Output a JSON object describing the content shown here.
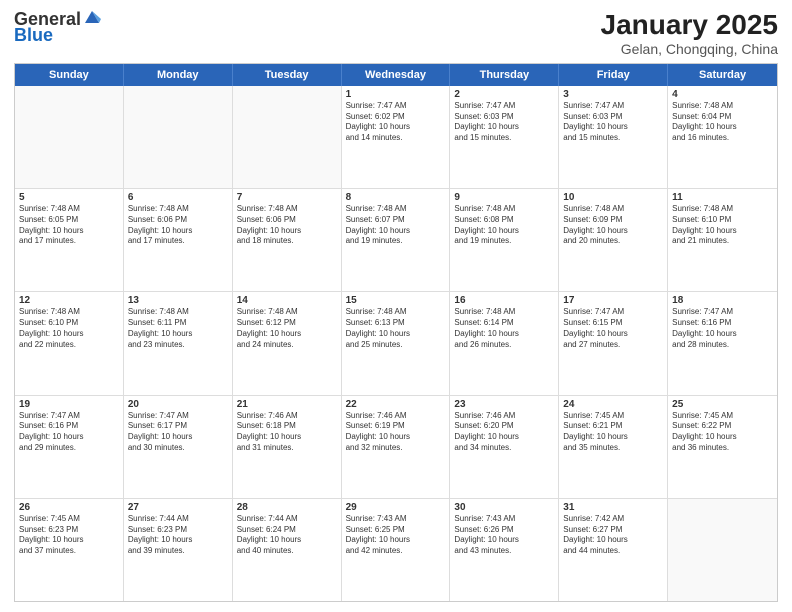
{
  "header": {
    "logo_general": "General",
    "logo_blue": "Blue",
    "title": "January 2025",
    "subtitle": "Gelan, Chongqing, China"
  },
  "weekdays": [
    "Sunday",
    "Monday",
    "Tuesday",
    "Wednesday",
    "Thursday",
    "Friday",
    "Saturday"
  ],
  "rows": [
    [
      {
        "day": "",
        "lines": [],
        "empty": true
      },
      {
        "day": "",
        "lines": [],
        "empty": true
      },
      {
        "day": "",
        "lines": [],
        "empty": true
      },
      {
        "day": "1",
        "lines": [
          "Sunrise: 7:47 AM",
          "Sunset: 6:02 PM",
          "Daylight: 10 hours",
          "and 14 minutes."
        ]
      },
      {
        "day": "2",
        "lines": [
          "Sunrise: 7:47 AM",
          "Sunset: 6:03 PM",
          "Daylight: 10 hours",
          "and 15 minutes."
        ]
      },
      {
        "day": "3",
        "lines": [
          "Sunrise: 7:47 AM",
          "Sunset: 6:03 PM",
          "Daylight: 10 hours",
          "and 15 minutes."
        ]
      },
      {
        "day": "4",
        "lines": [
          "Sunrise: 7:48 AM",
          "Sunset: 6:04 PM",
          "Daylight: 10 hours",
          "and 16 minutes."
        ]
      }
    ],
    [
      {
        "day": "5",
        "lines": [
          "Sunrise: 7:48 AM",
          "Sunset: 6:05 PM",
          "Daylight: 10 hours",
          "and 17 minutes."
        ]
      },
      {
        "day": "6",
        "lines": [
          "Sunrise: 7:48 AM",
          "Sunset: 6:06 PM",
          "Daylight: 10 hours",
          "and 17 minutes."
        ]
      },
      {
        "day": "7",
        "lines": [
          "Sunrise: 7:48 AM",
          "Sunset: 6:06 PM",
          "Daylight: 10 hours",
          "and 18 minutes."
        ]
      },
      {
        "day": "8",
        "lines": [
          "Sunrise: 7:48 AM",
          "Sunset: 6:07 PM",
          "Daylight: 10 hours",
          "and 19 minutes."
        ]
      },
      {
        "day": "9",
        "lines": [
          "Sunrise: 7:48 AM",
          "Sunset: 6:08 PM",
          "Daylight: 10 hours",
          "and 19 minutes."
        ]
      },
      {
        "day": "10",
        "lines": [
          "Sunrise: 7:48 AM",
          "Sunset: 6:09 PM",
          "Daylight: 10 hours",
          "and 20 minutes."
        ]
      },
      {
        "day": "11",
        "lines": [
          "Sunrise: 7:48 AM",
          "Sunset: 6:10 PM",
          "Daylight: 10 hours",
          "and 21 minutes."
        ]
      }
    ],
    [
      {
        "day": "12",
        "lines": [
          "Sunrise: 7:48 AM",
          "Sunset: 6:10 PM",
          "Daylight: 10 hours",
          "and 22 minutes."
        ]
      },
      {
        "day": "13",
        "lines": [
          "Sunrise: 7:48 AM",
          "Sunset: 6:11 PM",
          "Daylight: 10 hours",
          "and 23 minutes."
        ]
      },
      {
        "day": "14",
        "lines": [
          "Sunrise: 7:48 AM",
          "Sunset: 6:12 PM",
          "Daylight: 10 hours",
          "and 24 minutes."
        ]
      },
      {
        "day": "15",
        "lines": [
          "Sunrise: 7:48 AM",
          "Sunset: 6:13 PM",
          "Daylight: 10 hours",
          "and 25 minutes."
        ]
      },
      {
        "day": "16",
        "lines": [
          "Sunrise: 7:48 AM",
          "Sunset: 6:14 PM",
          "Daylight: 10 hours",
          "and 26 minutes."
        ]
      },
      {
        "day": "17",
        "lines": [
          "Sunrise: 7:47 AM",
          "Sunset: 6:15 PM",
          "Daylight: 10 hours",
          "and 27 minutes."
        ]
      },
      {
        "day": "18",
        "lines": [
          "Sunrise: 7:47 AM",
          "Sunset: 6:16 PM",
          "Daylight: 10 hours",
          "and 28 minutes."
        ]
      }
    ],
    [
      {
        "day": "19",
        "lines": [
          "Sunrise: 7:47 AM",
          "Sunset: 6:16 PM",
          "Daylight: 10 hours",
          "and 29 minutes."
        ]
      },
      {
        "day": "20",
        "lines": [
          "Sunrise: 7:47 AM",
          "Sunset: 6:17 PM",
          "Daylight: 10 hours",
          "and 30 minutes."
        ]
      },
      {
        "day": "21",
        "lines": [
          "Sunrise: 7:46 AM",
          "Sunset: 6:18 PM",
          "Daylight: 10 hours",
          "and 31 minutes."
        ]
      },
      {
        "day": "22",
        "lines": [
          "Sunrise: 7:46 AM",
          "Sunset: 6:19 PM",
          "Daylight: 10 hours",
          "and 32 minutes."
        ]
      },
      {
        "day": "23",
        "lines": [
          "Sunrise: 7:46 AM",
          "Sunset: 6:20 PM",
          "Daylight: 10 hours",
          "and 34 minutes."
        ]
      },
      {
        "day": "24",
        "lines": [
          "Sunrise: 7:45 AM",
          "Sunset: 6:21 PM",
          "Daylight: 10 hours",
          "and 35 minutes."
        ]
      },
      {
        "day": "25",
        "lines": [
          "Sunrise: 7:45 AM",
          "Sunset: 6:22 PM",
          "Daylight: 10 hours",
          "and 36 minutes."
        ]
      }
    ],
    [
      {
        "day": "26",
        "lines": [
          "Sunrise: 7:45 AM",
          "Sunset: 6:23 PM",
          "Daylight: 10 hours",
          "and 37 minutes."
        ]
      },
      {
        "day": "27",
        "lines": [
          "Sunrise: 7:44 AM",
          "Sunset: 6:23 PM",
          "Daylight: 10 hours",
          "and 39 minutes."
        ]
      },
      {
        "day": "28",
        "lines": [
          "Sunrise: 7:44 AM",
          "Sunset: 6:24 PM",
          "Daylight: 10 hours",
          "and 40 minutes."
        ]
      },
      {
        "day": "29",
        "lines": [
          "Sunrise: 7:43 AM",
          "Sunset: 6:25 PM",
          "Daylight: 10 hours",
          "and 42 minutes."
        ]
      },
      {
        "day": "30",
        "lines": [
          "Sunrise: 7:43 AM",
          "Sunset: 6:26 PM",
          "Daylight: 10 hours",
          "and 43 minutes."
        ]
      },
      {
        "day": "31",
        "lines": [
          "Sunrise: 7:42 AM",
          "Sunset: 6:27 PM",
          "Daylight: 10 hours",
          "and 44 minutes."
        ]
      },
      {
        "day": "",
        "lines": [],
        "empty": true
      }
    ]
  ]
}
